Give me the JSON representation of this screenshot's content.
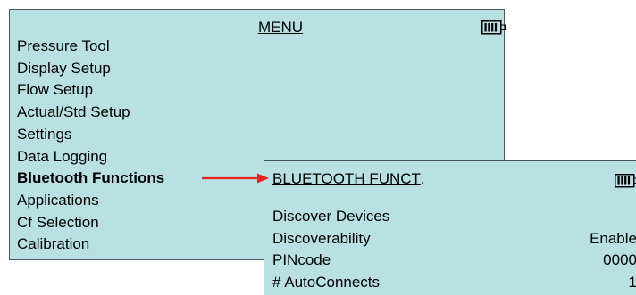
{
  "menu": {
    "title": "MENU",
    "items": [
      {
        "label": "Pressure Tool"
      },
      {
        "label": "Display Setup"
      },
      {
        "label": "Flow Setup"
      },
      {
        "label": "Actual/Std Setup"
      },
      {
        "label": "Settings"
      },
      {
        "label": "Data Logging"
      },
      {
        "label": "Bluetooth Functions",
        "selected": true
      },
      {
        "label": "Applications"
      },
      {
        "label": "Cf Selection"
      },
      {
        "label": "Calibration"
      }
    ]
  },
  "bluetooth": {
    "title": "BLUETOOTH FUNCT",
    "title_suffix": ".",
    "items": [
      {
        "label": "Discover Devices",
        "value": ""
      },
      {
        "label": "Discoverability",
        "value": "Enable"
      },
      {
        "label": "PINcode",
        "value": "0000"
      },
      {
        "label": "# AutoConnects",
        "value": "1"
      }
    ]
  },
  "icons": {
    "battery": "battery-icon",
    "arrow": "arrow-right-icon"
  },
  "colors": {
    "panel_background": "#b9e0e3",
    "arrow": "#e8201f"
  }
}
